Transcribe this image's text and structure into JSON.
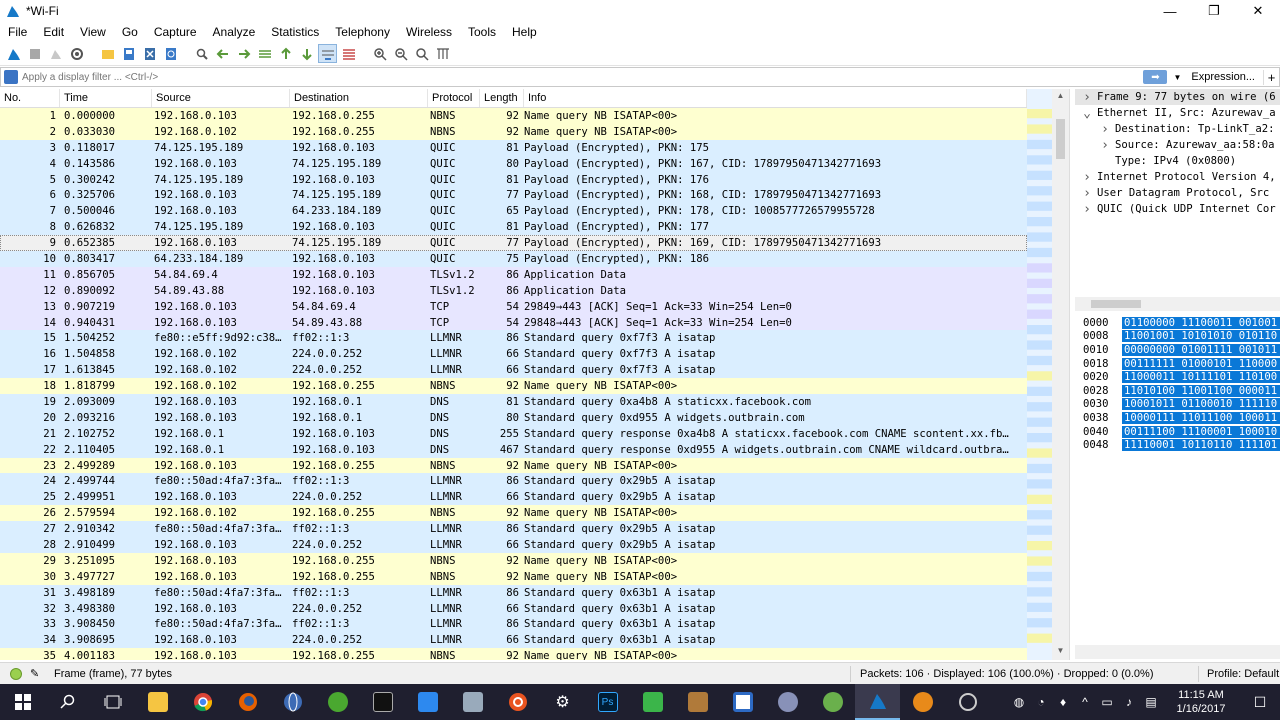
{
  "window": {
    "title": "*Wi-Fi",
    "minimize": "—",
    "maximize": "❐",
    "close": "✕"
  },
  "menu": [
    "File",
    "Edit",
    "View",
    "Go",
    "Capture",
    "Analyze",
    "Statistics",
    "Telephony",
    "Wireless",
    "Tools",
    "Help"
  ],
  "filter": {
    "placeholder": "Apply a display filter ... <Ctrl-/>",
    "expression_label": "Expression...",
    "plus": "+",
    "apply_icon": "➡",
    "dropdown": "▼"
  },
  "columns": {
    "no": "No.",
    "time": "Time",
    "source": "Source",
    "destination": "Destination",
    "protocol": "Protocol",
    "length": "Length",
    "info": "Info"
  },
  "packets": [
    {
      "no": "1",
      "time": "0.000000",
      "src": "192.168.0.103",
      "dst": "192.168.0.255",
      "proto": "NBNS",
      "len": "92",
      "info": "Name query NB ISATAP<00>"
    },
    {
      "no": "2",
      "time": "0.033030",
      "src": "192.168.0.102",
      "dst": "192.168.0.255",
      "proto": "NBNS",
      "len": "92",
      "info": "Name query NB ISATAP<00>"
    },
    {
      "no": "3",
      "time": "0.118017",
      "src": "74.125.195.189",
      "dst": "192.168.0.103",
      "proto": "QUIC",
      "len": "81",
      "info": "Payload (Encrypted), PKN: 175"
    },
    {
      "no": "4",
      "time": "0.143586",
      "src": "192.168.0.103",
      "dst": "74.125.195.189",
      "proto": "QUIC",
      "len": "80",
      "info": "Payload (Encrypted), PKN: 167, CID: 17897950471342771693"
    },
    {
      "no": "5",
      "time": "0.300242",
      "src": "74.125.195.189",
      "dst": "192.168.0.103",
      "proto": "QUIC",
      "len": "81",
      "info": "Payload (Encrypted), PKN: 176"
    },
    {
      "no": "6",
      "time": "0.325706",
      "src": "192.168.0.103",
      "dst": "74.125.195.189",
      "proto": "QUIC",
      "len": "77",
      "info": "Payload (Encrypted), PKN: 168, CID: 17897950471342771693"
    },
    {
      "no": "7",
      "time": "0.500046",
      "src": "192.168.0.103",
      "dst": "64.233.184.189",
      "proto": "QUIC",
      "len": "65",
      "info": "Payload (Encrypted), PKN: 178, CID: 1008577726579955728"
    },
    {
      "no": "8",
      "time": "0.626832",
      "src": "74.125.195.189",
      "dst": "192.168.0.103",
      "proto": "QUIC",
      "len": "81",
      "info": "Payload (Encrypted), PKN: 177"
    },
    {
      "no": "9",
      "time": "0.652385",
      "src": "192.168.0.103",
      "dst": "74.125.195.189",
      "proto": "QUIC",
      "len": "77",
      "info": "Payload (Encrypted), PKN: 169, CID: 17897950471342771693"
    },
    {
      "no": "10",
      "time": "0.803417",
      "src": "64.233.184.189",
      "dst": "192.168.0.103",
      "proto": "QUIC",
      "len": "75",
      "info": "Payload (Encrypted), PKN: 186"
    },
    {
      "no": "11",
      "time": "0.856705",
      "src": "54.84.69.4",
      "dst": "192.168.0.103",
      "proto": "TLSv1.2",
      "len": "86",
      "info": "Application Data"
    },
    {
      "no": "12",
      "time": "0.890092",
      "src": "54.89.43.88",
      "dst": "192.168.0.103",
      "proto": "TLSv1.2",
      "len": "86",
      "info": "Application Data"
    },
    {
      "no": "13",
      "time": "0.907219",
      "src": "192.168.0.103",
      "dst": "54.84.69.4",
      "proto": "TCP",
      "len": "54",
      "info": "29849→443 [ACK] Seq=1 Ack=33 Win=254 Len=0"
    },
    {
      "no": "14",
      "time": "0.940431",
      "src": "192.168.0.103",
      "dst": "54.89.43.88",
      "proto": "TCP",
      "len": "54",
      "info": "29848→443 [ACK] Seq=1 Ack=33 Win=254 Len=0"
    },
    {
      "no": "15",
      "time": "1.504252",
      "src": "fe80::e5ff:9d92:c38…",
      "dst": "ff02::1:3",
      "proto": "LLMNR",
      "len": "86",
      "info": "Standard query 0xf7f3 A isatap"
    },
    {
      "no": "16",
      "time": "1.504858",
      "src": "192.168.0.102",
      "dst": "224.0.0.252",
      "proto": "LLMNR",
      "len": "66",
      "info": "Standard query 0xf7f3 A isatap"
    },
    {
      "no": "17",
      "time": "1.613845",
      "src": "192.168.0.102",
      "dst": "224.0.0.252",
      "proto": "LLMNR",
      "len": "66",
      "info": "Standard query 0xf7f3 A isatap"
    },
    {
      "no": "18",
      "time": "1.818799",
      "src": "192.168.0.102",
      "dst": "192.168.0.255",
      "proto": "NBNS",
      "len": "92",
      "info": "Name query NB ISATAP<00>"
    },
    {
      "no": "19",
      "time": "2.093009",
      "src": "192.168.0.103",
      "dst": "192.168.0.1",
      "proto": "DNS",
      "len": "81",
      "info": "Standard query 0xa4b8 A staticxx.facebook.com"
    },
    {
      "no": "20",
      "time": "2.093216",
      "src": "192.168.0.103",
      "dst": "192.168.0.1",
      "proto": "DNS",
      "len": "80",
      "info": "Standard query 0xd955 A widgets.outbrain.com"
    },
    {
      "no": "21",
      "time": "2.102752",
      "src": "192.168.0.1",
      "dst": "192.168.0.103",
      "proto": "DNS",
      "len": "255",
      "info": "Standard query response 0xa4b8 A staticxx.facebook.com CNAME scontent.xx.fb…"
    },
    {
      "no": "22",
      "time": "2.110405",
      "src": "192.168.0.1",
      "dst": "192.168.0.103",
      "proto": "DNS",
      "len": "467",
      "info": "Standard query response 0xd955 A widgets.outbrain.com CNAME wildcard.outbra…"
    },
    {
      "no": "23",
      "time": "2.499289",
      "src": "192.168.0.103",
      "dst": "192.168.0.255",
      "proto": "NBNS",
      "len": "92",
      "info": "Name query NB ISATAP<00>"
    },
    {
      "no": "24",
      "time": "2.499744",
      "src": "fe80::50ad:4fa7:3fa…",
      "dst": "ff02::1:3",
      "proto": "LLMNR",
      "len": "86",
      "info": "Standard query 0x29b5 A isatap"
    },
    {
      "no": "25",
      "time": "2.499951",
      "src": "192.168.0.103",
      "dst": "224.0.0.252",
      "proto": "LLMNR",
      "len": "66",
      "info": "Standard query 0x29b5 A isatap"
    },
    {
      "no": "26",
      "time": "2.579594",
      "src": "192.168.0.102",
      "dst": "192.168.0.255",
      "proto": "NBNS",
      "len": "92",
      "info": "Name query NB ISATAP<00>"
    },
    {
      "no": "27",
      "time": "2.910342",
      "src": "fe80::50ad:4fa7:3fa…",
      "dst": "ff02::1:3",
      "proto": "LLMNR",
      "len": "86",
      "info": "Standard query 0x29b5 A isatap"
    },
    {
      "no": "28",
      "time": "2.910499",
      "src": "192.168.0.103",
      "dst": "224.0.0.252",
      "proto": "LLMNR",
      "len": "66",
      "info": "Standard query 0x29b5 A isatap"
    },
    {
      "no": "29",
      "time": "3.251095",
      "src": "192.168.0.103",
      "dst": "192.168.0.255",
      "proto": "NBNS",
      "len": "92",
      "info": "Name query NB ISATAP<00>"
    },
    {
      "no": "30",
      "time": "3.497727",
      "src": "192.168.0.103",
      "dst": "192.168.0.255",
      "proto": "NBNS",
      "len": "92",
      "info": "Name query NB ISATAP<00>"
    },
    {
      "no": "31",
      "time": "3.498189",
      "src": "fe80::50ad:4fa7:3fa…",
      "dst": "ff02::1:3",
      "proto": "LLMNR",
      "len": "86",
      "info": "Standard query 0x63b1 A isatap"
    },
    {
      "no": "32",
      "time": "3.498380",
      "src": "192.168.0.103",
      "dst": "224.0.0.252",
      "proto": "LLMNR",
      "len": "66",
      "info": "Standard query 0x63b1 A isatap"
    },
    {
      "no": "33",
      "time": "3.908450",
      "src": "fe80::50ad:4fa7:3fa…",
      "dst": "ff02::1:3",
      "proto": "LLMNR",
      "len": "86",
      "info": "Standard query 0x63b1 A isatap"
    },
    {
      "no": "34",
      "time": "3.908695",
      "src": "192.168.0.103",
      "dst": "224.0.0.252",
      "proto": "LLMNR",
      "len": "66",
      "info": "Standard query 0x63b1 A isatap"
    },
    {
      "no": "35",
      "time": "4.001183",
      "src": "192.168.0.103",
      "dst": "192.168.0.255",
      "proto": "NBNS",
      "len": "92",
      "info": "Name query NB ISATAP<00>"
    }
  ],
  "selected_packet": "9",
  "details": [
    {
      "text": "Frame 9: 77 bytes on wire (6",
      "indent": 0,
      "arrow": ">"
    },
    {
      "text": "Ethernet II, Src: Azurewav_a",
      "indent": 0,
      "arrow": "v"
    },
    {
      "text": "Destination: Tp-LinkT_a2:",
      "indent": 1,
      "arrow": ">"
    },
    {
      "text": "Source: Azurewav_aa:58:0a",
      "indent": 1,
      "arrow": ">"
    },
    {
      "text": "Type: IPv4 (0x0800)",
      "indent": 1,
      "arrow": ""
    },
    {
      "text": "Internet Protocol Version 4,",
      "indent": 0,
      "arrow": ">"
    },
    {
      "text": "User Datagram Protocol, Src",
      "indent": 0,
      "arrow": ">"
    },
    {
      "text": "QUIC (Quick UDP Internet Cor",
      "indent": 0,
      "arrow": ">"
    }
  ],
  "bytes": [
    {
      "off": "0000",
      "hex": "01100000 11100011 001001"
    },
    {
      "off": "0008",
      "hex": "11001001 10101010 010110"
    },
    {
      "off": "0010",
      "hex": "00000000 01001111 001011"
    },
    {
      "off": "0018",
      "hex": "00111111 01000101 110000"
    },
    {
      "off": "0020",
      "hex": "11000011 10111101 110100"
    },
    {
      "off": "0028",
      "hex": "11010100 11001100 000011"
    },
    {
      "off": "0030",
      "hex": "10001011 01100010 111110"
    },
    {
      "off": "0038",
      "hex": "10000111 11011100 100011"
    },
    {
      "off": "0040",
      "hex": "00111100 11100001 100010"
    },
    {
      "off": "0048",
      "hex": "11110001 10110110 111101"
    }
  ],
  "status": {
    "frame": "Frame (frame), 77 bytes",
    "packets": "Packets: 106 · Displayed: 106 (100.0%) · Dropped: 0 (0.0%)",
    "profile": "Profile: Default"
  },
  "taskbar": {
    "time": "11:15 AM",
    "date": "1/16/2017"
  },
  "colors": {
    "nbns": "#feffd0",
    "quic": "#daeeff",
    "tls": "#e7e6ff",
    "selected_bytes": "#0a78d7",
    "taskbar": "#1f1f2f"
  }
}
